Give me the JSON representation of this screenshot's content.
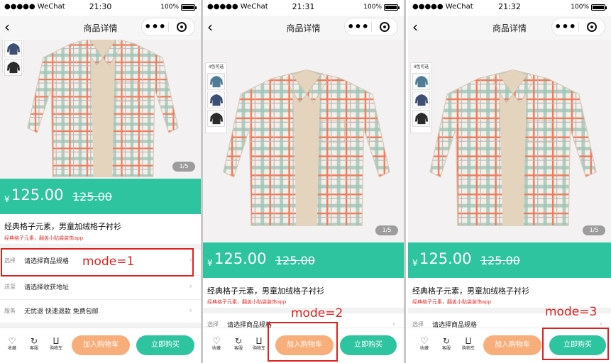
{
  "status": {
    "carrier": "●●●●● WeChat",
    "battery": "100%",
    "times": [
      "21:30",
      "21:31",
      "21:32"
    ]
  },
  "nav": {
    "back_icon": "chevron-left-icon",
    "title": "商品详情",
    "more": "•••",
    "capsule_icon": "target-circle-icon"
  },
  "gallery": {
    "counter": "1/5",
    "color_caption": "4色可选"
  },
  "price": {
    "currency": "¥",
    "current": "125.00",
    "original": "125.00",
    "bg_color": "#2fc4a0"
  },
  "product": {
    "name": "经典格子元素，男童加绒格子衬衫",
    "promo": "经典格子元素，翻盖小贴袋装饰app"
  },
  "rows": {
    "select_label": "选择",
    "select_value": "请选择商品规格",
    "ship_label": "送至",
    "ship_value": "请选择收获地址",
    "service_label": "服务",
    "service_value": "无忧退 快速退款 免费包邮"
  },
  "bottom": {
    "fav": "收藏",
    "service": "客服",
    "cart": "购物车",
    "add_cart": "加入购物车",
    "buy_now": "立即购买",
    "cart_color": "#f8ae7a",
    "buy_color": "#2fc4a0"
  },
  "annotations": {
    "mode1": "mode=1",
    "mode2": "mode=2",
    "mode3": "mode=3",
    "color": "#e02020"
  }
}
